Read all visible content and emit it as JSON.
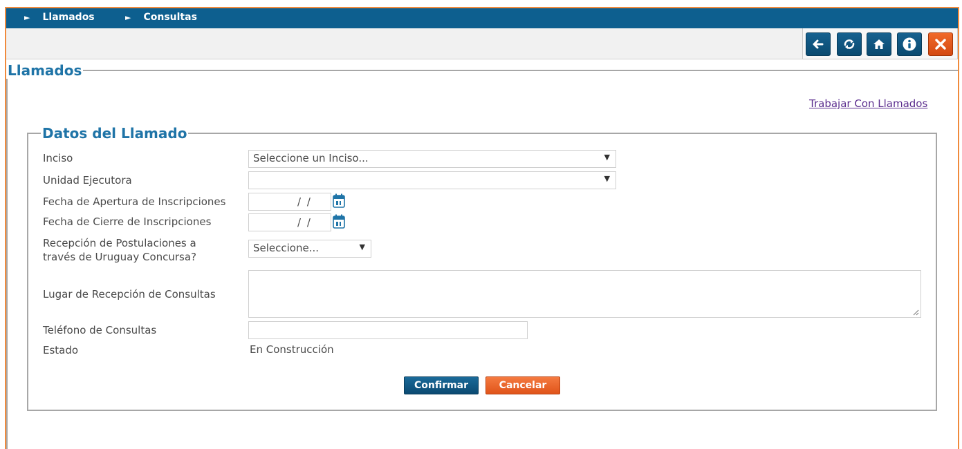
{
  "breadcrumb": {
    "items": [
      {
        "arrow": "►",
        "label": "Llamados"
      },
      {
        "arrow": "►",
        "label": "Consultas"
      }
    ]
  },
  "toolbar": {
    "buttons": [
      {
        "name": "back",
        "icon": "arrow-left-icon"
      },
      {
        "name": "refresh",
        "icon": "refresh-icon"
      },
      {
        "name": "home",
        "icon": "home-icon"
      },
      {
        "name": "info",
        "icon": "info-icon"
      },
      {
        "name": "close",
        "icon": "close-icon"
      }
    ]
  },
  "section": {
    "title": "Llamados",
    "link_label": "Trabajar Con Llamados"
  },
  "form": {
    "legend": "Datos del Llamado",
    "inciso": {
      "label": "Inciso",
      "value": "Seleccione un Inciso..."
    },
    "unidad": {
      "label": "Unidad Ejecutora",
      "value": ""
    },
    "fecha_apertura": {
      "label": "Fecha de Apertura de Inscripciones",
      "value": "/ /"
    },
    "fecha_cierre": {
      "label": "Fecha de Cierre de Inscripciones",
      "value": "/ /"
    },
    "recepcion": {
      "label_line1": "Recepción de Postulaciones a",
      "label_line2": "través de Uruguay Concursa?",
      "value": "Seleccione..."
    },
    "lugar": {
      "label": "Lugar de Recepción de Consultas",
      "value": ""
    },
    "telefono": {
      "label": "Teléfono de Consultas",
      "value": ""
    },
    "estado": {
      "label": "Estado",
      "value": "En Construcción"
    },
    "confirm_label": "Confirmar",
    "cancel_label": "Cancelar",
    "caret": "▼"
  },
  "colors": {
    "topbar": "#0d5f8f",
    "accent_blue": "#1f74a7",
    "accent_orange": "#f08a3c",
    "link": "#5b2d8e"
  }
}
